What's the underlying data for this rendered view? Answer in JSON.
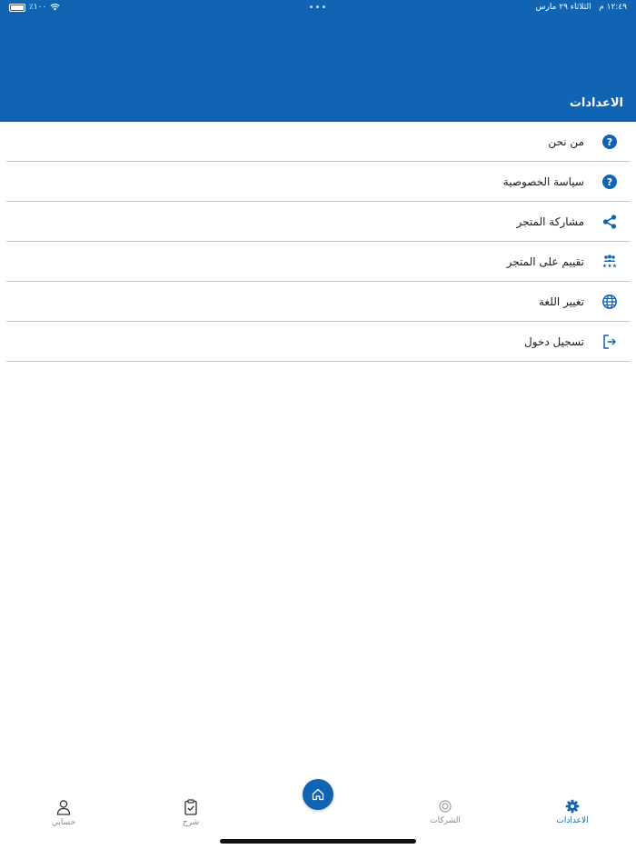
{
  "status_bar": {
    "time": "١٢:٤٩ م",
    "date": "الثلاثاء ٢٩ مارس",
    "battery": "٪١٠٠",
    "dots": "•••"
  },
  "header": {
    "title": "الاعدادات"
  },
  "menu": {
    "items": [
      {
        "label": "من نحن",
        "icon": "question-icon"
      },
      {
        "label": "سياسة الخصوصية",
        "icon": "question-icon"
      },
      {
        "label": "مشاركة المتجر",
        "icon": "share-icon"
      },
      {
        "label": "تقييم على المتجر",
        "icon": "rating-people-icon"
      },
      {
        "label": "تغيير اللغة",
        "icon": "globe-icon"
      },
      {
        "label": "تسجيل دخول",
        "icon": "login-icon"
      }
    ]
  },
  "tabbar": {
    "account": "حسابي",
    "cart": "شرح",
    "home_icon": "home-icon",
    "companies": "الشركات",
    "settings": "الاعدادات"
  },
  "colors": {
    "primary": "#1163b4",
    "divider": "#c8c8c8",
    "inactive": "#8a8a8a"
  }
}
